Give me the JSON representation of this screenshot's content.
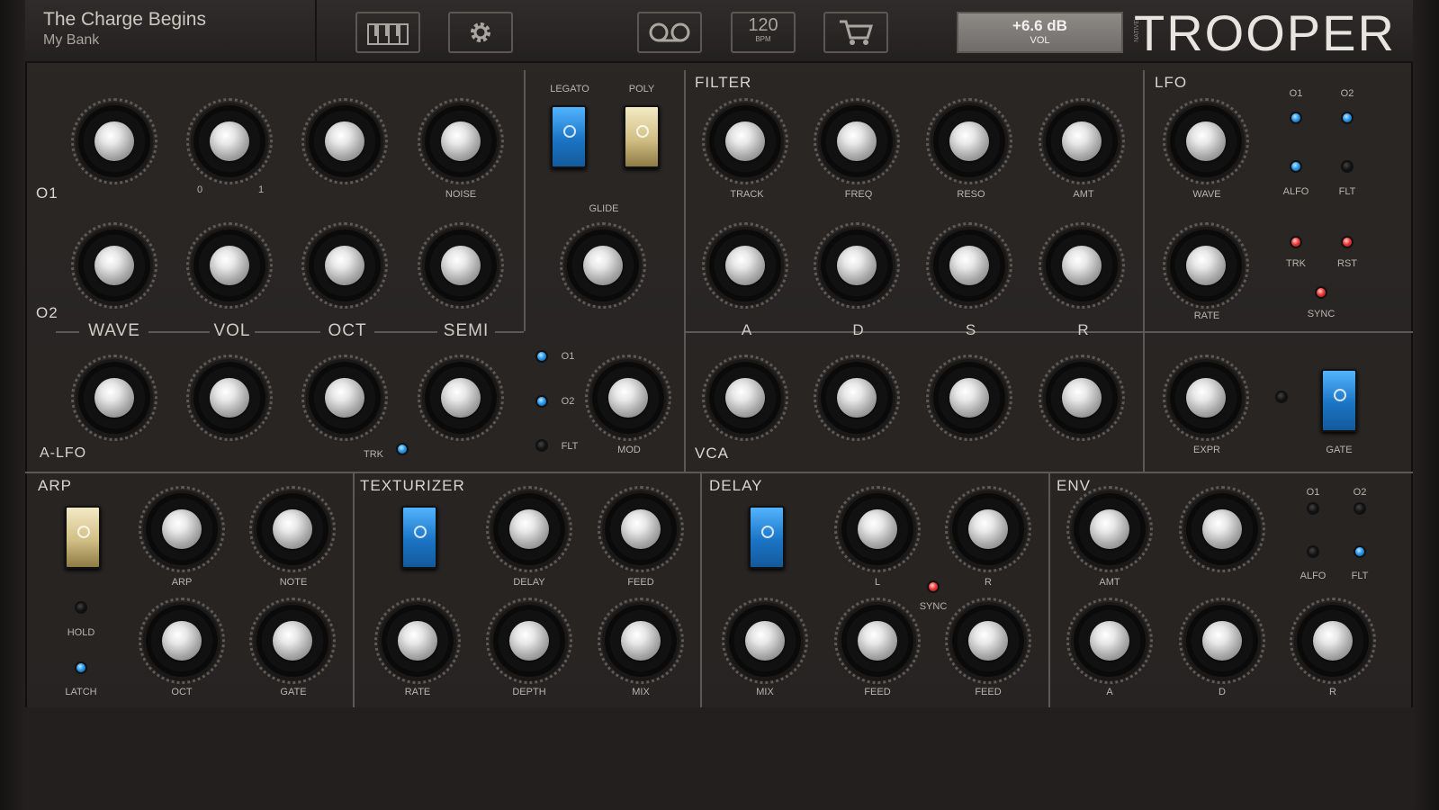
{
  "header": {
    "preset_name": "The Charge Begins",
    "bank_name": "My Bank",
    "keyboard_icon": "keyboard-icon",
    "settings_icon": "gear-icon",
    "tape_icon": "tape-icon",
    "bpm_label": "120",
    "bpm_unit": "BPM",
    "cart_icon": "cart-icon",
    "volume_value": "+6.6 dB",
    "volume_label": "VOL",
    "logo": "TROOPER",
    "logo_prefix": "NATIVE"
  },
  "osc": {
    "o1_label": "O1",
    "o2_label": "O2",
    "alfo_label": "A-LFO",
    "col_wave": "WAVE",
    "col_vol": "VOL",
    "col_oct": "OCT",
    "col_semi": "SEMI",
    "noise_label": "NOISE",
    "trk_label": "TRK",
    "vol_min": "0",
    "vol_max": "1"
  },
  "mode": {
    "legato": "LEGATO",
    "poly": "POLY",
    "glide": "GLIDE",
    "o1": "O1",
    "o2": "O2",
    "flt": "FLT",
    "mod": "MOD"
  },
  "filter": {
    "title": "FILTER",
    "track": "TRACK",
    "freq": "FREQ",
    "reso": "RESO",
    "amt": "AMT",
    "a": "A",
    "d": "D",
    "s": "S",
    "r": "R",
    "vca": "VCA"
  },
  "lfo": {
    "title": "LFO",
    "wave": "WAVE",
    "o1": "O1",
    "o2": "O2",
    "alfo": "ALFO",
    "flt": "FLT",
    "rate": "RATE",
    "trk": "TRK",
    "rst": "RST",
    "sync": "SYNC",
    "expr": "EXPR",
    "gate": "GATE"
  },
  "arp": {
    "title": "ARP",
    "arp_label": "ARP",
    "note": "NOTE",
    "hold": "HOLD",
    "latch": "LATCH",
    "oct": "OCT",
    "gate": "GATE"
  },
  "texturizer": {
    "title": "TEXTURIZER",
    "delay": "DELAY",
    "feed": "FEED",
    "rate": "RATE",
    "depth": "DEPTH",
    "mix": "MIX"
  },
  "delay": {
    "title": "DELAY",
    "l": "L",
    "r": "R",
    "sync": "SYNC",
    "mix": "MIX",
    "feed": "FEED"
  },
  "env": {
    "title": "ENV",
    "amt": "AMT",
    "o1": "O1",
    "o2": "O2",
    "alfo": "ALFO",
    "flt": "FLT",
    "a": "A",
    "d": "D",
    "r": "R"
  }
}
